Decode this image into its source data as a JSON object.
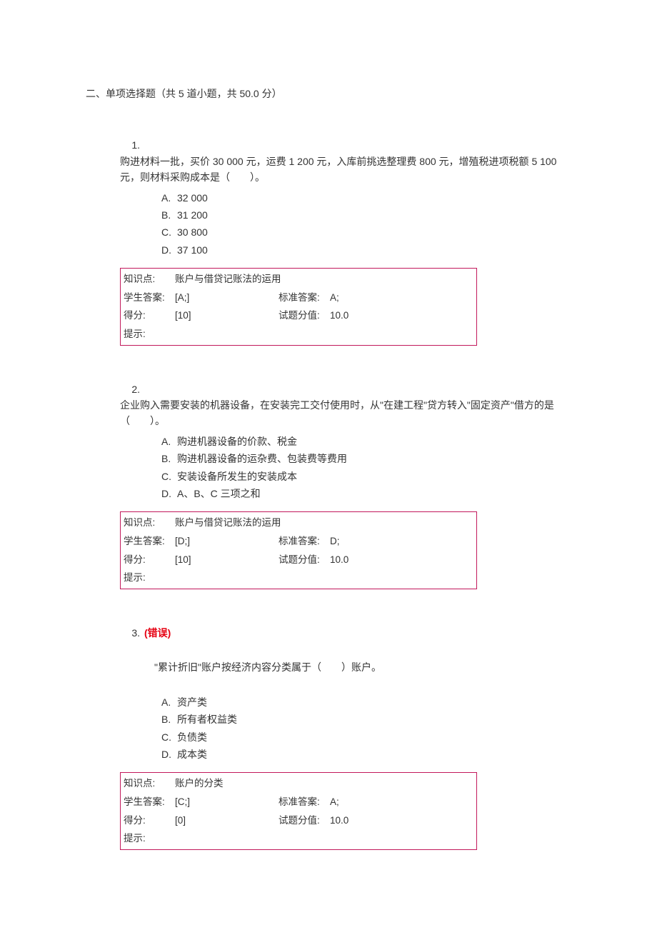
{
  "section": {
    "title": "二、单项选择题（共 5 道小题，共 50.0 分）"
  },
  "questions": [
    {
      "number": "1.",
      "stem": "购进材料一批，买价 30 000 元，运费 1 200 元，入库前挑选整理费 800 元，增殖税进项税额 5 100 元，则材料采购成本是（　　）。",
      "options": [
        {
          "letter": "A.",
          "text": "32 000"
        },
        {
          "letter": "B.",
          "text": "31 200"
        },
        {
          "letter": "C.",
          "text": "30 800"
        },
        {
          "letter": "D.",
          "text": "37 100"
        }
      ],
      "box": {
        "knowledge_label": "知识点:",
        "knowledge_value": "账户与借贷记账法的运用",
        "student_label": "学生答案:",
        "student_value": "[A;]",
        "standard_label": "标准答案:",
        "standard_value": "A;",
        "score_label": "得分:",
        "score_value": "[10]",
        "full_label": "试题分值:",
        "full_value": "10.0",
        "hint_label": "提示:"
      }
    },
    {
      "number": "2.",
      "stem": "企业购入需要安装的机器设备，在安装完工交付使用时，从\"在建工程\"贷方转入\"固定资产\"借方的是（　　）。",
      "options": [
        {
          "letter": "A.",
          "text": "购进机器设备的价款、税金"
        },
        {
          "letter": "B.",
          "text": "购进机器设备的运杂费、包装费等费用"
        },
        {
          "letter": "C.",
          "text": "安装设备所发生的安装成本"
        },
        {
          "letter": "D.",
          "text": "A、B、C 三项之和"
        }
      ],
      "box": {
        "knowledge_label": "知识点:",
        "knowledge_value": "账户与借贷记账法的运用",
        "student_label": "学生答案:",
        "student_value": "[D;]",
        "standard_label": "标准答案:",
        "standard_value": "D;",
        "score_label": "得分:",
        "score_value": "[10]",
        "full_label": "试题分值:",
        "full_value": "10.0",
        "hint_label": "提示:"
      }
    },
    {
      "number": "3.",
      "error": "(错误)",
      "stem": "\"累计折旧\"账户按经济内容分类属于（　　）账户。",
      "options": [
        {
          "letter": "A.",
          "text": "资产类"
        },
        {
          "letter": "B.",
          "text": "所有者权益类"
        },
        {
          "letter": "C.",
          "text": "负债类"
        },
        {
          "letter": "D.",
          "text": "成本类"
        }
      ],
      "box": {
        "knowledge_label": "知识点:",
        "knowledge_value": "账户的分类",
        "student_label": "学生答案:",
        "student_value": "[C;]",
        "standard_label": "标准答案:",
        "standard_value": "A;",
        "score_label": "得分:",
        "score_value": "[0]",
        "full_label": "试题分值:",
        "full_value": "10.0",
        "hint_label": "提示:"
      }
    }
  ]
}
